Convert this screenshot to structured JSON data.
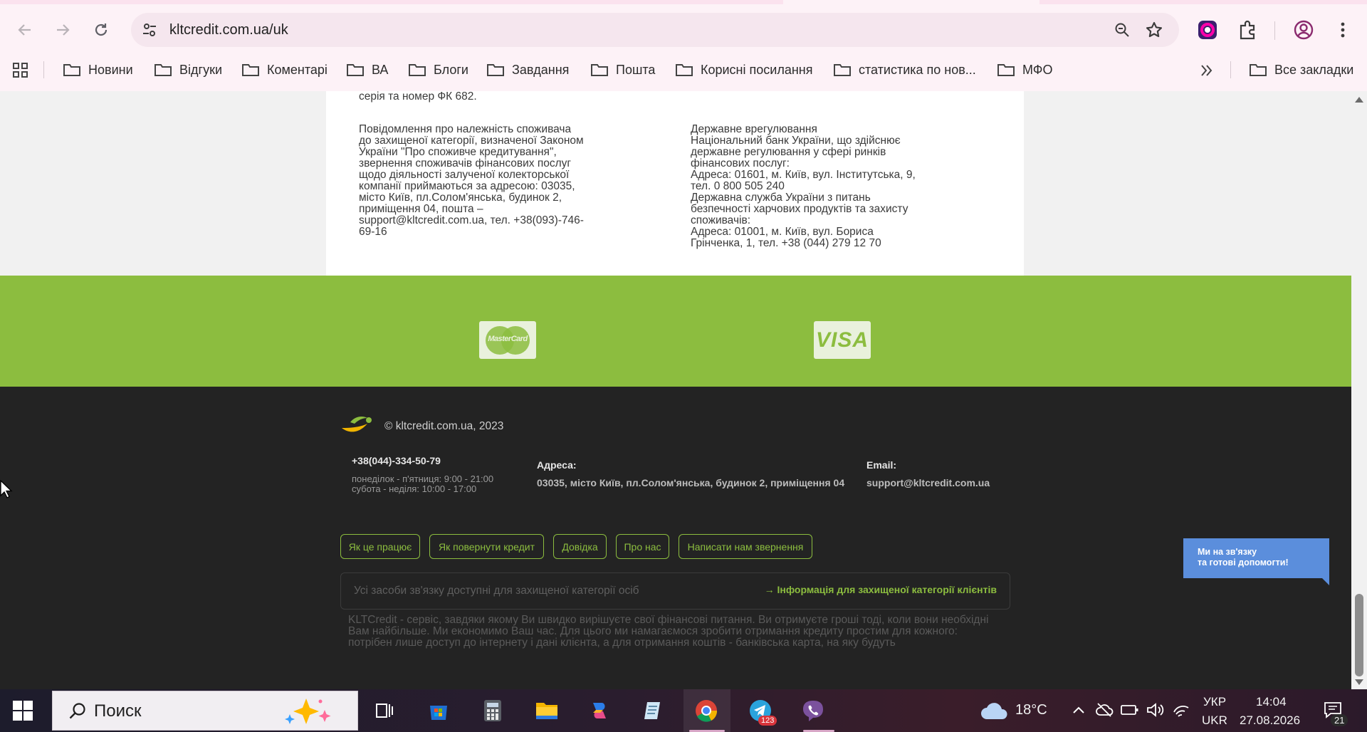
{
  "browser": {
    "url": "kltcredit.com.ua/uk",
    "bookmarks": [
      "Новини",
      "Відгуки",
      "Коментарі",
      "ВА",
      "Блоги",
      "Завдання",
      "Пошта",
      "Корисні посилання",
      "статистика по нов...",
      "МФО"
    ],
    "all_bookmarks": "Все закладки"
  },
  "card": {
    "partial_line": "серія та номер ФК 682.",
    "left_text": "Повідомлення про належність споживача\nдо захищеної категорії, визначеної Законом\nУкраїни \"Про споживче кредитування\",\nзвернення споживачів фінансових послуг\nщодо діяльності залученої колекторської\nкомпанії приймаються за адресою: 03035,\nмісто Київ, пл.Солом'янська, будинок 2,\nприміщення 04, пошта –\nsupport@kltcredit.com.ua, тел. +38(093)-746-\n69-16",
    "right_text": "Державне врегулювання\nНаціональний банк України, що здійснює\nдержавне регулювання у сфері ринків\nфінансових послуг:\nАдреса: 01601, м. Київ, вул. Інститутська, 9,\nтел. 0 800 505 240\nДержавна служба України з питань\nбезпечності харчових продуктів та захисту\nспоживачів:\nАдреса: 01001, м. Київ, вул. Бориса\nГрінченка, 1, тел. +38 (044) 279 12 70"
  },
  "payments": {
    "mastercard": "MasterCard",
    "visa": "VISA"
  },
  "footer": {
    "copyright": "© kltcredit.com.ua, 2023",
    "phone": "+38(044)-334-50-79",
    "hours_weekdays": "понеділок - п'ятниця: 9:00 - 21:00",
    "hours_weekend": "субота - неділя: 10:00 - 17:00",
    "address_label": "Адреса:",
    "address_value": "03035, місто Київ, пл.Солом'янська, будинок 2, приміщення 04",
    "email_label": "Email:",
    "email_value": "support@kltcredit.com.ua",
    "links": [
      "Як це працює",
      "Як повернути кредит",
      "Довідка",
      "Про нас",
      "Написати нам звернення"
    ],
    "info_placeholder": "Усі засоби зв'язку доступні для захищеної категорії осіб",
    "info_link": "→ Інформація для захищеної категорії клієнтів",
    "about": "KLTCredit - сервіс, завдяки якому Ви швидко вирішуєте свої фінансові питання. Ви отримуєте гроші тоді, коли вони необхідні Вам найбільше. Ми економимо Ваш час. Для цього ми намагаємося зробити отримання кредиту простим для кожного: потрібен лише доступ до інтернету і дані клієнта, а для отримання коштів - банківська карта, на яку будуть"
  },
  "chat": {
    "text": "Ми на зв'язку\nта готові допомогти!"
  },
  "taskbar": {
    "search_placeholder": "Поиск",
    "telegram_badge": "123",
    "weather": "18°C",
    "lang_top": "УКР",
    "lang_bottom": "UKR",
    "time": "14:04",
    "date": "27.08.2026",
    "notifications": "21"
  },
  "colors": {
    "brand_green": "#8cbd3f",
    "footer_dark": "#232323",
    "chat_blue": "#5b8edc"
  }
}
